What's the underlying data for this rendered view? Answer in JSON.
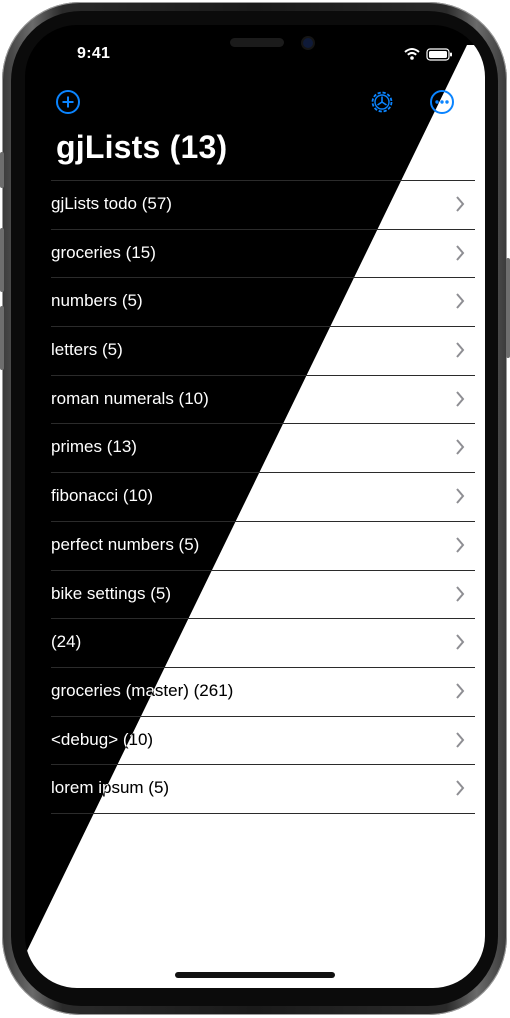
{
  "status_bar": {
    "time": "9:41"
  },
  "nav": {
    "add_icon": "plus-circle-icon",
    "settings_icon": "gear-badge-icon",
    "more_icon": "ellipsis-circle-icon"
  },
  "title": "gjLists (13)",
  "lists": [
    {
      "label": "gjLists todo (57)"
    },
    {
      "label": "groceries (15)"
    },
    {
      "label": "numbers (5)"
    },
    {
      "label": "letters (5)"
    },
    {
      "label": "roman numerals (10)"
    },
    {
      "label": "primes (13)"
    },
    {
      "label": "fibonacci (10)"
    },
    {
      "label": "perfect numbers (5)"
    },
    {
      "label": "bike settings (5)"
    },
    {
      "label": " (24)"
    },
    {
      "label": "groceries (master) (261)"
    },
    {
      "label": "<debug> (10)"
    },
    {
      "label": "lorem ipsum (5)"
    }
  ],
  "colors": {
    "accent": "#0a84ff",
    "dark_bg": "#000000",
    "light_bg": "#ffffff",
    "chevron": "#8e8e93"
  }
}
